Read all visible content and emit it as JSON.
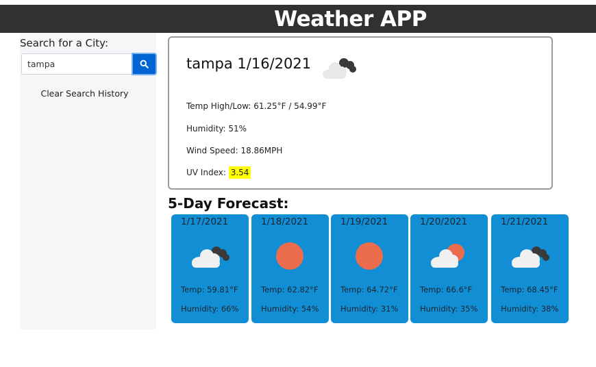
{
  "header": {
    "title": "Weather APP"
  },
  "sidebar": {
    "search_label": "Search for a City:",
    "search_value": "tampa",
    "search_button_icon": "search-icon",
    "clear_history_label": "Clear Search History"
  },
  "current": {
    "title": "tampa 1/16/2021",
    "icon": "cloudy-icon",
    "temp_label": "Temp High/Low: 61.25°F / 54.99°F",
    "humidity_label": "Humidity: 51%",
    "wind_label": "Wind Speed: 18.86MPH",
    "uv_label": "UV Index:",
    "uv_value": "3.54",
    "uv_color": "#ffff00"
  },
  "forecast": {
    "title": "5-Day Forecast:",
    "card_color": "#118ed4",
    "days": [
      {
        "date": "1/17/2021",
        "icon": "cloudy-icon",
        "temp": "Temp: 59.81°F",
        "humidity": "Humidity: 66%"
      },
      {
        "date": "1/18/2021",
        "icon": "sun-icon",
        "temp": "Temp: 62.82°F",
        "humidity": "Humidity: 54%"
      },
      {
        "date": "1/19/2021",
        "icon": "sun-icon",
        "temp": "Temp: 64.72°F",
        "humidity": "Humidity: 31%"
      },
      {
        "date": "1/20/2021",
        "icon": "partly-cloudy-icon",
        "temp": "Temp: 66.6°F",
        "humidity": "Humidity: 35%"
      },
      {
        "date": "1/21/2021",
        "icon": "cloudy-icon",
        "temp": "Temp: 68.45°F",
        "humidity": "Humidity: 38%"
      }
    ]
  }
}
